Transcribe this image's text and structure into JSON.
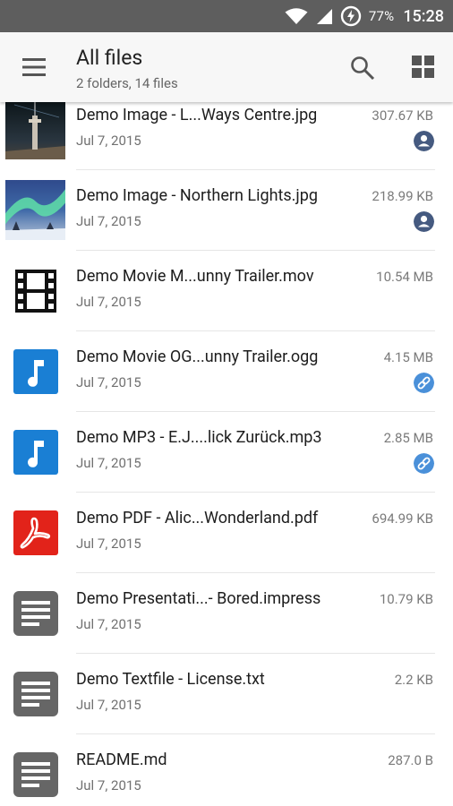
{
  "status_bar": {
    "battery_percent": "77%",
    "time": "15:28"
  },
  "app_bar": {
    "title": "All files",
    "subtitle": "2 folders, 14 files"
  },
  "colors": {
    "accent_blue": "#1a7fd4",
    "pdf_red": "#e2231a",
    "badge_dark": "#455a80",
    "badge_link": "#4a90d9"
  },
  "files": [
    {
      "name": "Demo Image - L...Ways Centre.jpg",
      "date": "Jul 7, 2015",
      "size": "307.67 KB",
      "icon": "image-thumbnail-tower",
      "badge": "shared-user-icon"
    },
    {
      "name": "Demo Image - Northern Lights.jpg",
      "date": "Jul 7, 2015",
      "size": "218.99 KB",
      "icon": "image-thumbnail-aurora",
      "badge": "shared-user-icon"
    },
    {
      "name": "Demo Movie M...unny Trailer.mov",
      "date": "Jul 7, 2015",
      "size": "10.54 MB",
      "icon": "film-icon",
      "badge": ""
    },
    {
      "name": "Demo Movie OG...unny Trailer.ogg",
      "date": "Jul 7, 2015",
      "size": "4.15 MB",
      "icon": "audio-file-icon",
      "badge": "link-icon"
    },
    {
      "name": "Demo MP3 - E.J....lick Zurück.mp3",
      "date": "Jul 7, 2015",
      "size": "2.85 MB",
      "icon": "audio-file-icon",
      "badge": "link-icon"
    },
    {
      "name": "Demo PDF - Alic...Wonderland.pdf",
      "date": "Jul 7, 2015",
      "size": "694.99 KB",
      "icon": "pdf-icon",
      "badge": ""
    },
    {
      "name": "Demo Presentati...- Bored.impress",
      "date": "Jul 7, 2015",
      "size": "10.79 KB",
      "icon": "text-document-icon",
      "badge": ""
    },
    {
      "name": "Demo Textfile - License.txt",
      "date": "Jul 7, 2015",
      "size": "2.2 KB",
      "icon": "text-document-icon",
      "badge": ""
    },
    {
      "name": "README.md",
      "date": "Jul 7, 2015",
      "size": "287.0 B",
      "icon": "text-document-icon",
      "badge": ""
    }
  ]
}
